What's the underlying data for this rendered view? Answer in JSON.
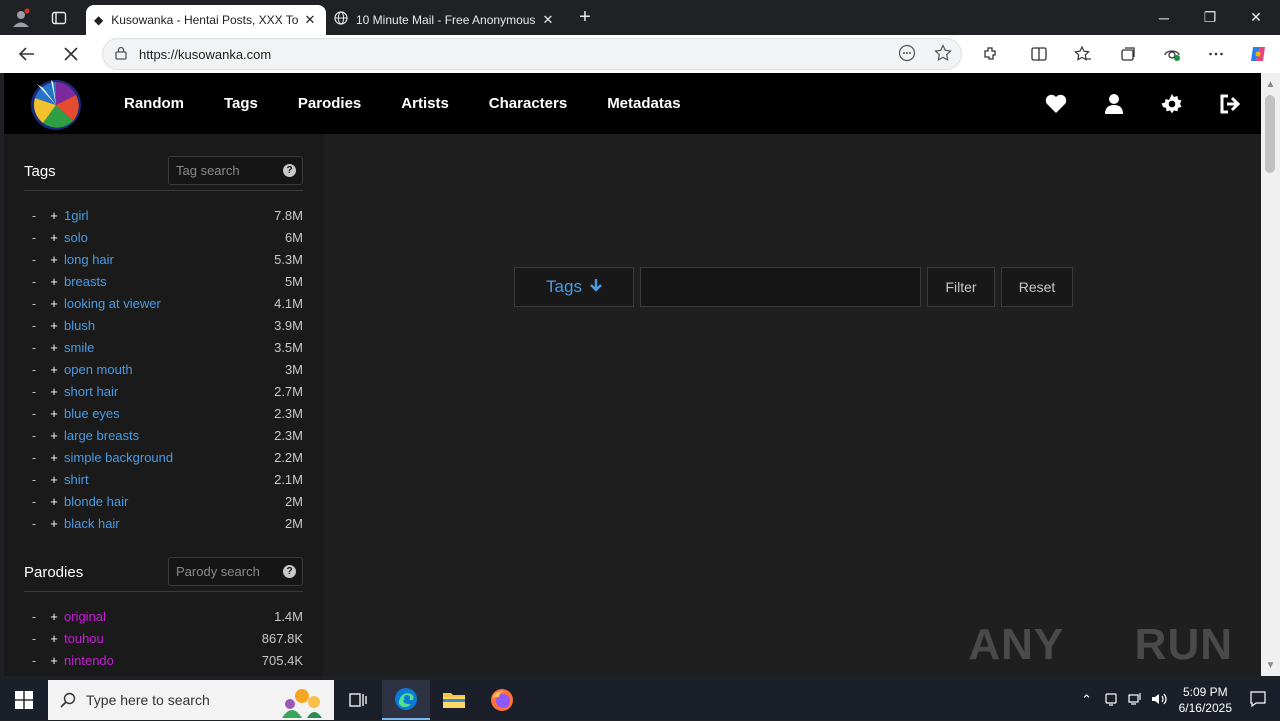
{
  "browser": {
    "tabs": [
      {
        "title": "Kusowanka - Hentai Posts, XXX To",
        "active": true
      },
      {
        "title": "10 Minute Mail - Free Anonymous",
        "active": false
      }
    ],
    "url": "https://kusowanka.com"
  },
  "nav": {
    "links": [
      "Random",
      "Tags",
      "Parodies",
      "Artists",
      "Characters",
      "Metadatas"
    ]
  },
  "sidebar": {
    "tags_section": {
      "label": "Tags",
      "search_placeholder": "Tag search",
      "help": "?",
      "items": [
        {
          "name": "1girl",
          "count": "7.8M"
        },
        {
          "name": "solo",
          "count": "6M"
        },
        {
          "name": "long hair",
          "count": "5.3M"
        },
        {
          "name": "breasts",
          "count": "5M"
        },
        {
          "name": "looking at viewer",
          "count": "4.1M"
        },
        {
          "name": "blush",
          "count": "3.9M"
        },
        {
          "name": "smile",
          "count": "3.5M"
        },
        {
          "name": "open mouth",
          "count": "3M"
        },
        {
          "name": "short hair",
          "count": "2.7M"
        },
        {
          "name": "blue eyes",
          "count": "2.3M"
        },
        {
          "name": "large breasts",
          "count": "2.3M"
        },
        {
          "name": "simple background",
          "count": "2.2M"
        },
        {
          "name": "shirt",
          "count": "2.1M"
        },
        {
          "name": "blonde hair",
          "count": "2M"
        },
        {
          "name": "black hair",
          "count": "2M"
        }
      ]
    },
    "parodies_section": {
      "label": "Parodies",
      "search_placeholder": "Parody search",
      "help": "?",
      "items": [
        {
          "name": "original",
          "count": "1.4M"
        },
        {
          "name": "touhou",
          "count": "867.8K"
        },
        {
          "name": "nintendo",
          "count": "705.4K"
        }
      ]
    },
    "minus": "-",
    "plus": "+"
  },
  "filter": {
    "tags_label": "Tags",
    "filter_label": "Filter",
    "reset_label": "Reset"
  },
  "watermark": "ANY RUN",
  "taskbar": {
    "search_placeholder": "Type here to search",
    "time": "5:09 PM",
    "date": "6/16/2025"
  },
  "colors": {
    "tag_link": "#4a9be6",
    "parody_link": "#c81ed8"
  }
}
